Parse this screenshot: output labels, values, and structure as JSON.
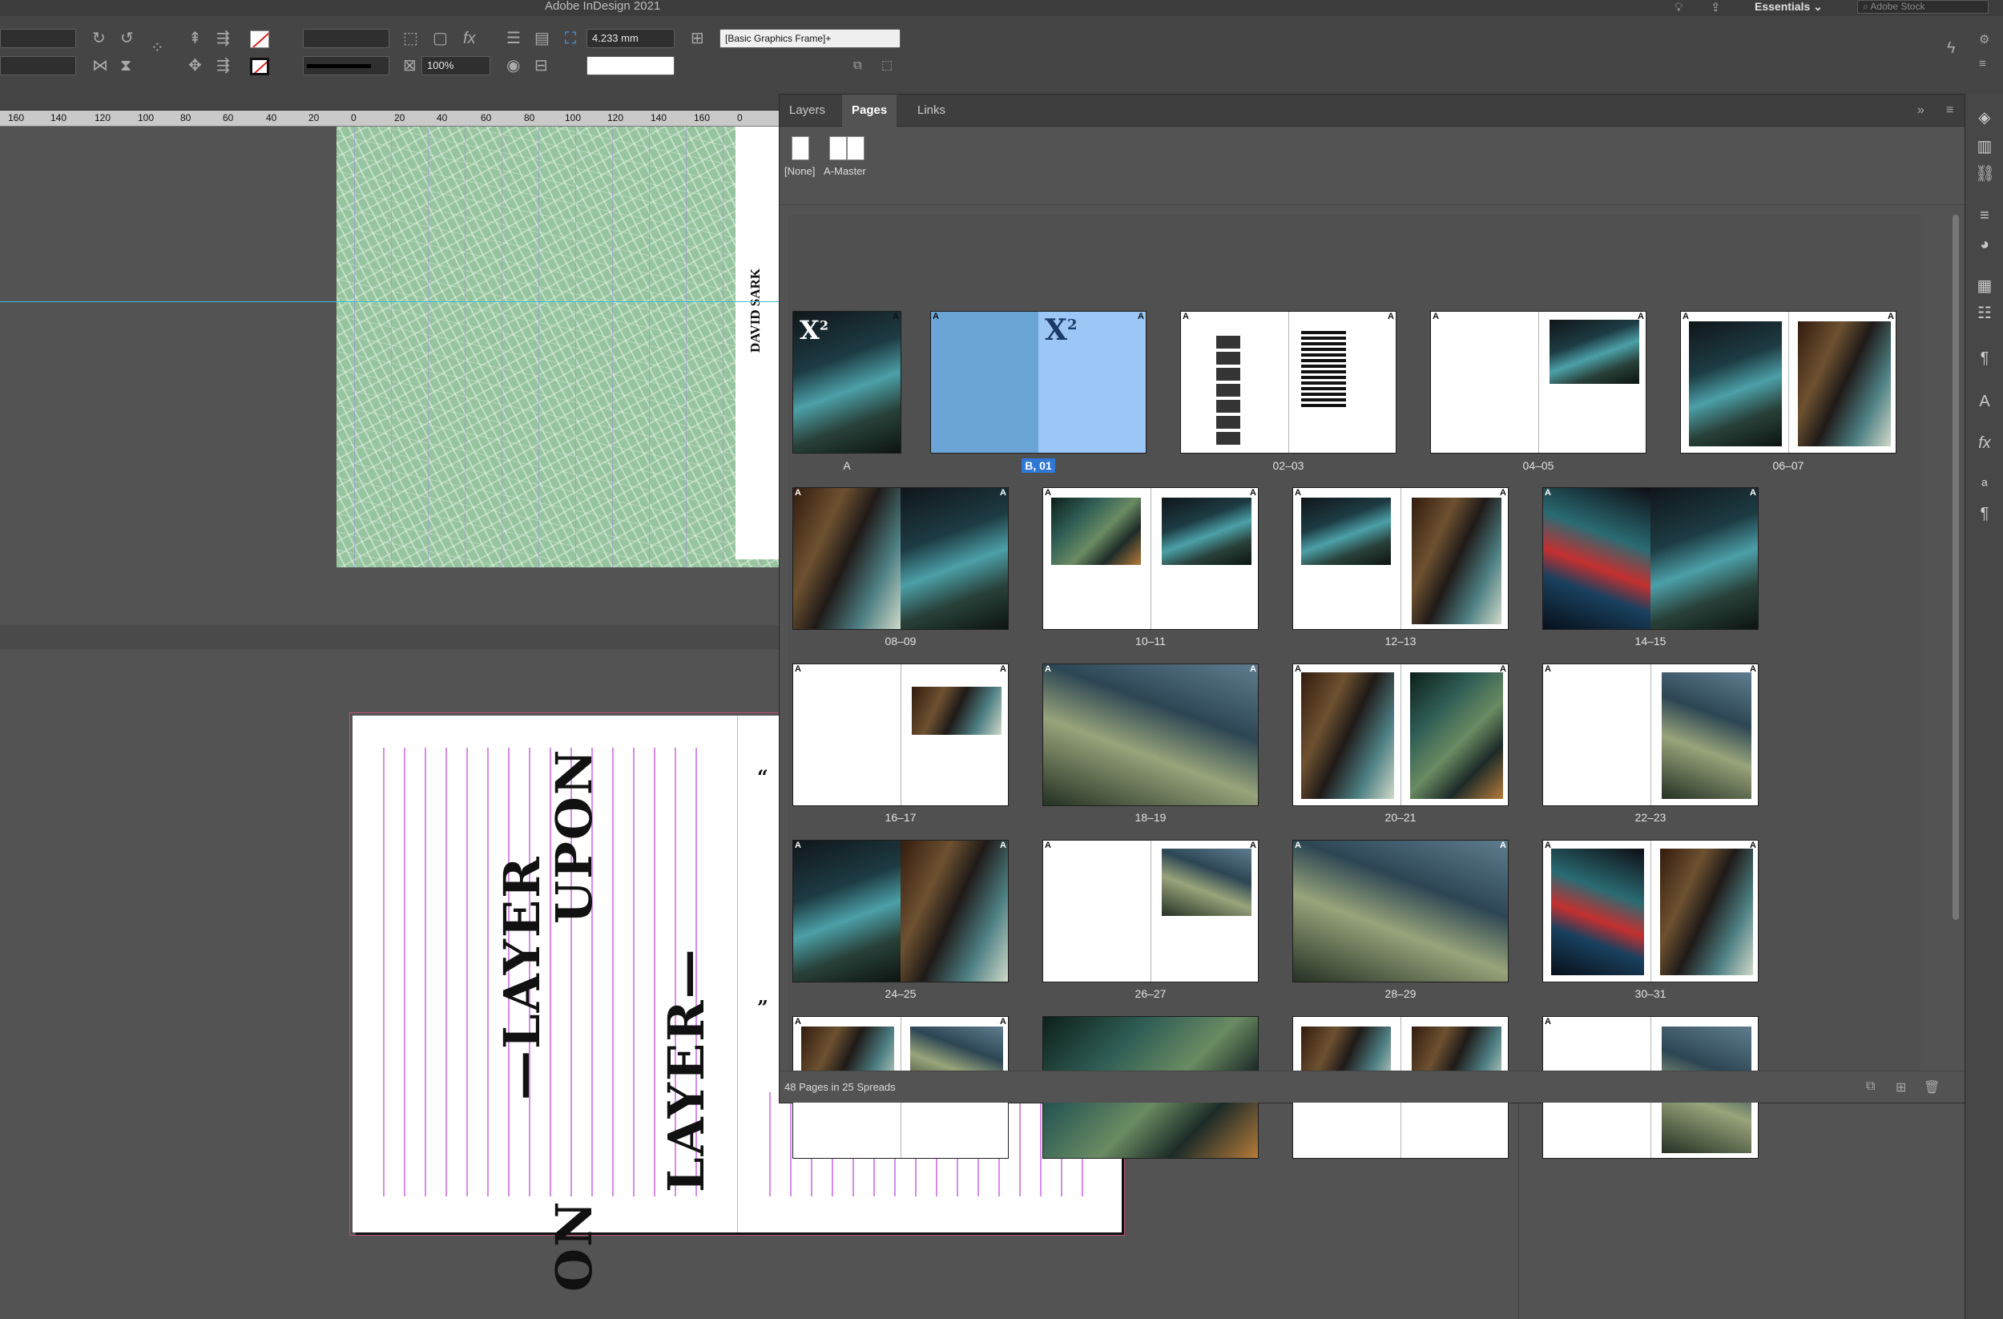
{
  "app": {
    "title": "Adobe InDesign 2021",
    "workspace": "Essentials",
    "stock_placeholder": "Adobe Stock"
  },
  "control": {
    "stroke_weight": "4.233 mm",
    "object_style": "[Basic Graphics Frame]+",
    "scale": "100%"
  },
  "ruler_ticks": [
    "160",
    "140",
    "120",
    "100",
    "80",
    "60",
    "40",
    "20",
    "0",
    "20",
    "40",
    "60",
    "80",
    "100",
    "120",
    "140",
    "160",
    "0"
  ],
  "canvas": {
    "spread_a_credit": "DAVID SARK",
    "layer_top": "—LAYER",
    "upon": "UPON",
    "layer_bottom": "LAYER—",
    "bottom_fragment": "ON"
  },
  "panel": {
    "tabs": [
      "Layers",
      "Pages",
      "Links"
    ],
    "active_tab": "Pages",
    "masters": [
      "[None]",
      "A-Master"
    ],
    "spread_labels": [
      "A",
      "B, 01",
      "02–03",
      "04–05",
      "06–07",
      "08–09",
      "10–11",
      "12–13",
      "14–15",
      "16–17",
      "18–19",
      "20–21",
      "22–23",
      "24–25",
      "26–27",
      "28–29",
      "30–31",
      "",
      "",
      "",
      ""
    ],
    "master_letter": "A",
    "x2": "X",
    "x2_sup": "2",
    "status": "48 Pages in 25 Spreads"
  },
  "icons": [
    "undo-icon",
    "redo-icon",
    "selection-icon",
    "lightbulb-icon",
    "share-icon",
    "search-icon",
    "layers-icon",
    "pages-icon",
    "links-icon",
    "stroke-icon",
    "color-icon",
    "swatches-icon",
    "properties-icon",
    "paragraph-icon",
    "character-icon",
    "effects-icon",
    "paragraph-styles-icon",
    "character-styles-icon"
  ]
}
